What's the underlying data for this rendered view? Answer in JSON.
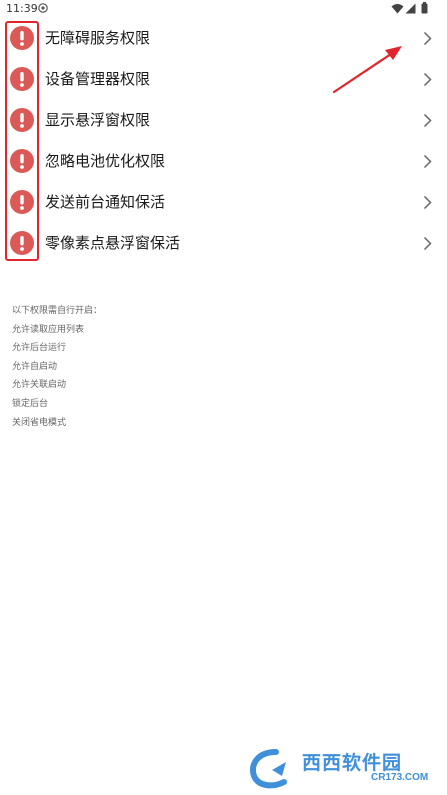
{
  "status_bar": {
    "time": "11:39",
    "app_icon": "shield-icon",
    "wifi_icon": "wifi-icon",
    "signal_icon": "signal-icon",
    "battery_icon": "battery-icon"
  },
  "permissions": [
    {
      "label": "无障碍服务权限",
      "status_icon": "warning-icon"
    },
    {
      "label": "设备管理器权限",
      "status_icon": "warning-icon"
    },
    {
      "label": "显示悬浮窗权限",
      "status_icon": "warning-icon"
    },
    {
      "label": "忽略电池优化权限",
      "status_icon": "warning-icon"
    },
    {
      "label": "发送前台通知保活",
      "status_icon": "warning-icon"
    },
    {
      "label": "零像素点悬浮窗保活",
      "status_icon": "warning-icon"
    }
  ],
  "manual_note": {
    "title": "以下权限需自行开启：",
    "items": [
      "允许读取应用列表",
      "允许后台运行",
      "允许自启动",
      "允许关联启动",
      "锁定后台",
      "关闭省电模式"
    ]
  },
  "watermark": {
    "name": "西西软件园",
    "url": "CR173.COM"
  },
  "colors": {
    "warning": "#db5a58",
    "annotation": "#e0262b",
    "watermark": "#3f8fd9",
    "note_text": "#666666"
  }
}
